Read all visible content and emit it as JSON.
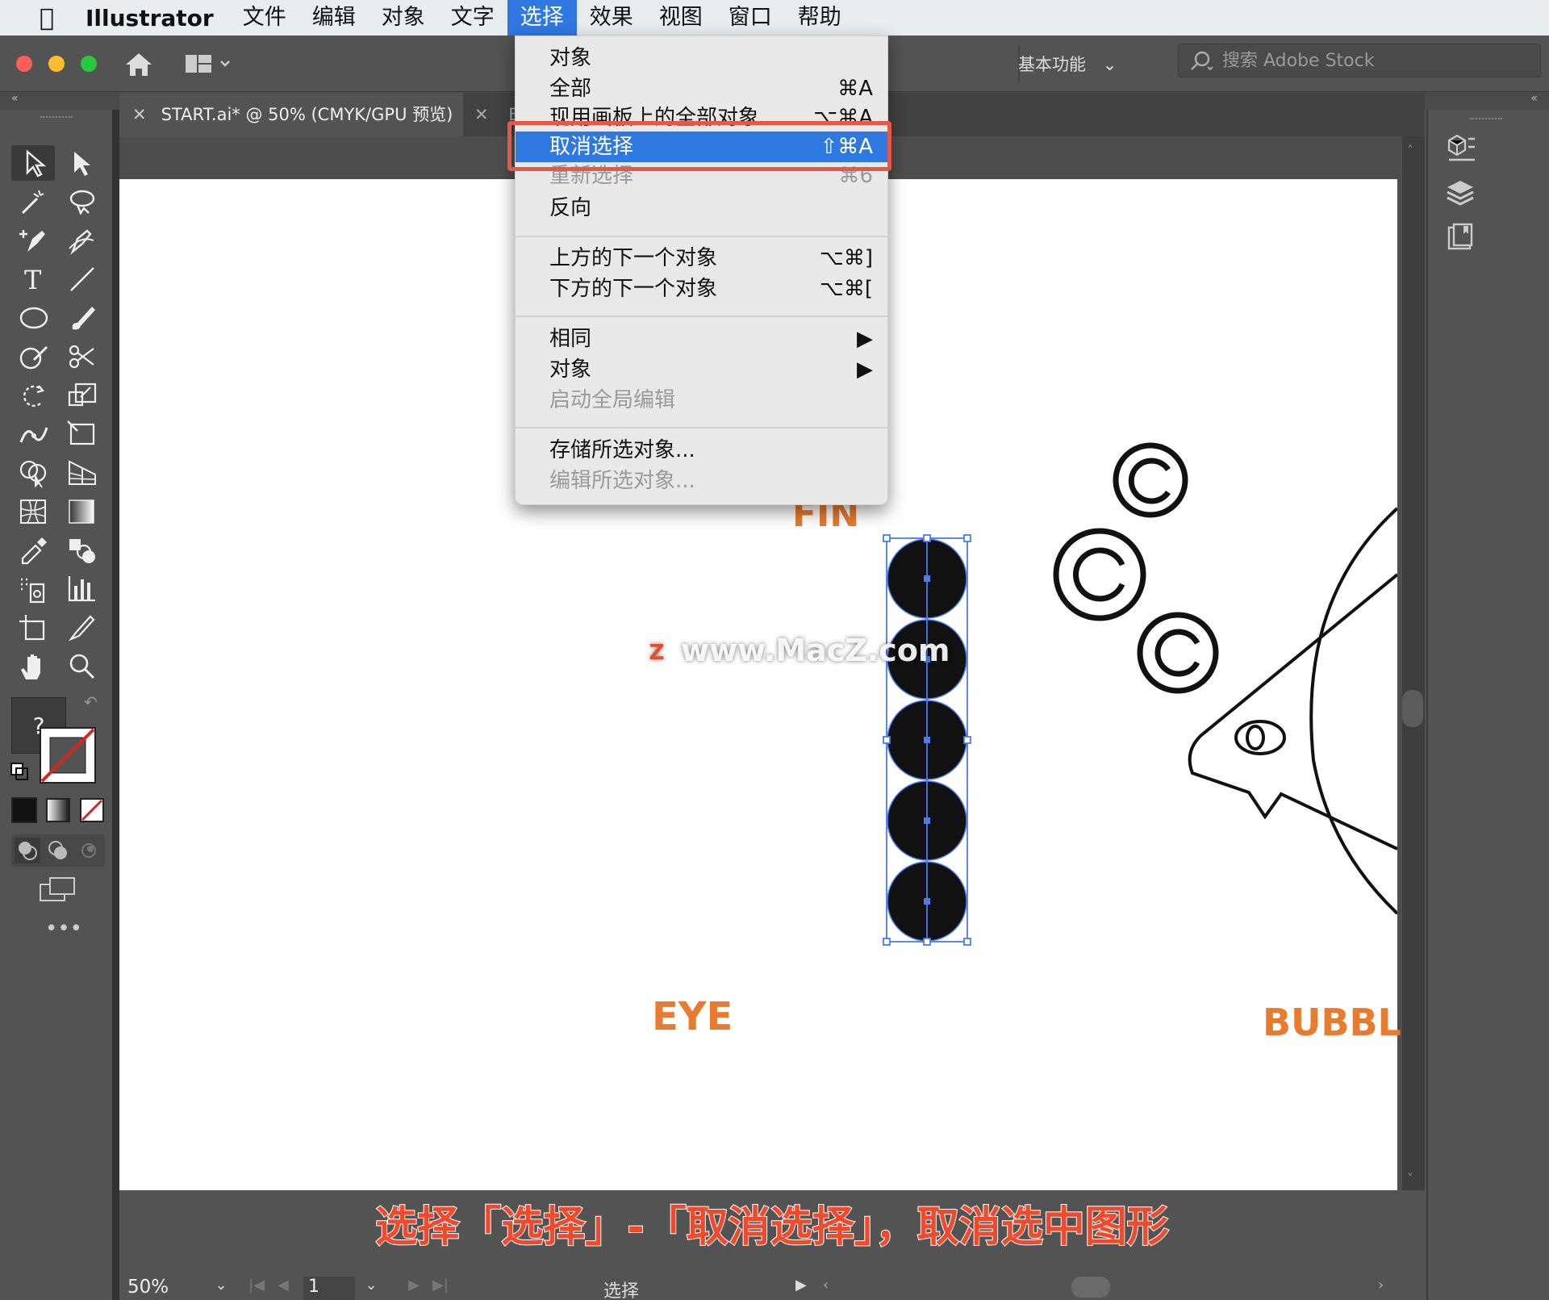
{
  "menubar": {
    "app_name": "Illustrator",
    "items": [
      "文件",
      "编辑",
      "对象",
      "文字",
      "选择",
      "效果",
      "视图",
      "窗口",
      "帮助"
    ],
    "active_item": "选择"
  },
  "toolbar": {
    "workspace_label": "基本功能",
    "stock_search_placeholder": "搜索 Adobe Stock"
  },
  "document_tab": {
    "title": "START.ai* @ 50% (CMYK/GPU 预览)",
    "second_tab_partial": "E"
  },
  "select_menu": {
    "items": [
      {
        "label": "对象",
        "shortcut": "",
        "disabled": false
      },
      {
        "label": "全部",
        "shortcut": "⌘A",
        "disabled": false
      },
      {
        "label": "现用画板上的全部对象",
        "shortcut": "⌥⌘A",
        "disabled": false
      },
      {
        "label": "取消选择",
        "shortcut": "⇧⌘A",
        "disabled": false,
        "highlighted": true
      },
      {
        "label": "重新选择",
        "shortcut": "⌘6",
        "disabled": true
      },
      {
        "label": "反向",
        "shortcut": "",
        "disabled": false
      },
      {
        "label": "上方的下一个对象",
        "shortcut": "⌥⌘]",
        "disabled": false
      },
      {
        "label": "下方的下一个对象",
        "shortcut": "⌥⌘[",
        "disabled": false
      },
      {
        "label": "相同",
        "shortcut": "▶",
        "disabled": false
      },
      {
        "label": "对象",
        "shortcut": "▶",
        "disabled": false
      },
      {
        "label": "启动全局编辑",
        "shortcut": "",
        "disabled": true
      },
      {
        "label": "存储所选对象...",
        "shortcut": "",
        "disabled": false
      },
      {
        "label": "编辑所选对象...",
        "shortcut": "",
        "disabled": true
      }
    ]
  },
  "artwork": {
    "label_fin": "FIN",
    "label_eye": "EYE",
    "label_bubble": "BUBBL"
  },
  "watermark": "www.MacZ.com",
  "watermark_icon": "Z",
  "subtitle": "选择「选择」-「取消选择」，取消选中图形",
  "statusbar": {
    "zoom": "50%",
    "page": "1",
    "status": "选择"
  },
  "fill_question": "?",
  "colors": {
    "accent_blue": "#2f78e0",
    "highlight_red": "#e4574a",
    "label_orange": "#e87b2d",
    "panel_gray": "#535353"
  }
}
